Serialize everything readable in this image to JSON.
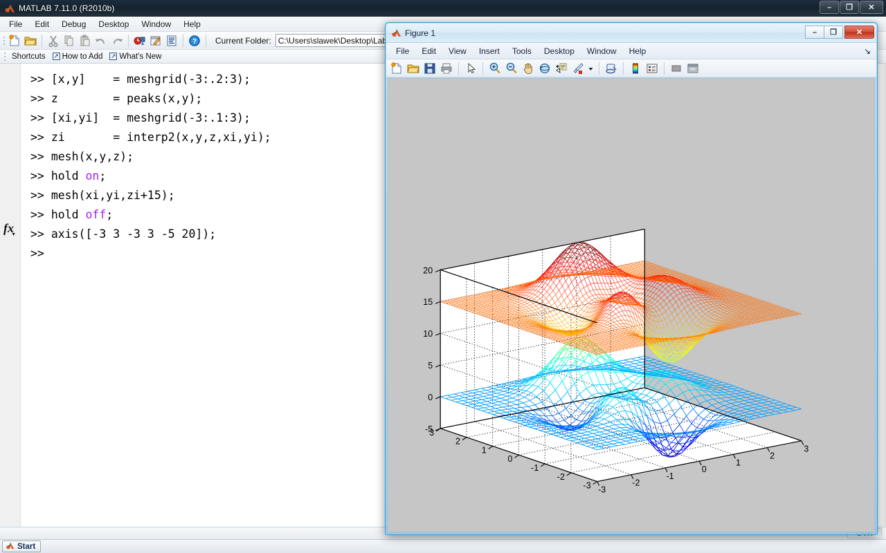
{
  "matlab": {
    "title": "MATLAB  7.11.0 (R2010b)",
    "title_icon": "matlab-logo-icon",
    "window_buttons": [
      {
        "name": "minimize-button",
        "glyph": "–"
      },
      {
        "name": "restore-button",
        "glyph": "❐"
      },
      {
        "name": "close-button",
        "glyph": "✕"
      }
    ],
    "menus": [
      "File",
      "Edit",
      "Debug",
      "Desktop",
      "Window",
      "Help"
    ],
    "toolbar": [
      {
        "name": "new-file-icon",
        "tip": "New"
      },
      {
        "name": "open-file-icon",
        "tip": "Open"
      },
      {
        "name": "separator"
      },
      {
        "name": "cut-icon",
        "tip": "Cut"
      },
      {
        "name": "copy-icon",
        "tip": "Copy"
      },
      {
        "name": "paste-icon",
        "tip": "Paste"
      },
      {
        "name": "undo-icon",
        "tip": "Undo"
      },
      {
        "name": "redo-icon",
        "tip": "Redo"
      },
      {
        "name": "separator"
      },
      {
        "name": "simulink-icon",
        "tip": "Simulink Library"
      },
      {
        "name": "guide-icon",
        "tip": "GUIDE"
      },
      {
        "name": "profiler-icon",
        "tip": "Profiler"
      },
      {
        "name": "separator"
      },
      {
        "name": "help-icon",
        "tip": "Help"
      }
    ],
    "current_folder": {
      "label": "Current Folder:",
      "value": "C:\\Users\\slawek\\Desktop\\Lab",
      "browse_icon": "browse-folder-icon"
    },
    "shortcuts": [
      {
        "name": "shortcuts-label",
        "label": "Shortcuts",
        "arrow": false
      },
      {
        "name": "how-to-add-link",
        "label": "How to Add",
        "arrow": true
      },
      {
        "name": "whats-new-link",
        "label": "What's New",
        "arrow": true
      }
    ],
    "command_window": {
      "prompt": ">>",
      "lines": [
        {
          "prompt": ">> ",
          "parts": [
            {
              "t": "[x,y]    = meshgrid(-3:.2:3);",
              "kw": false
            }
          ]
        },
        {
          "prompt": ">> ",
          "parts": [
            {
              "t": "z        = peaks(x,y);",
              "kw": false
            }
          ]
        },
        {
          "prompt": ">> ",
          "parts": [
            {
              "t": "[xi,yi]  = meshgrid(-3:.1:3);",
              "kw": false
            }
          ]
        },
        {
          "prompt": ">> ",
          "parts": [
            {
              "t": "zi       = interp2(x,y,z,xi,yi);",
              "kw": false
            }
          ]
        },
        {
          "prompt": ">> ",
          "parts": [
            {
              "t": "mesh(x,y,z);",
              "kw": false
            }
          ]
        },
        {
          "prompt": ">> ",
          "parts": [
            {
              "t": "hold ",
              "kw": false
            },
            {
              "t": "on",
              "kw": true
            },
            {
              "t": ";",
              "kw": false
            }
          ]
        },
        {
          "prompt": ">> ",
          "parts": [
            {
              "t": "mesh(xi,yi,zi+15);",
              "kw": false
            }
          ]
        },
        {
          "prompt": ">> ",
          "parts": [
            {
              "t": "hold ",
              "kw": false
            },
            {
              "t": "off",
              "kw": true
            },
            {
              "t": ";",
              "kw": false
            }
          ]
        },
        {
          "prompt": ">> ",
          "parts": [
            {
              "t": "axis([-3 3 -3 3 -5 20]);",
              "kw": false
            }
          ]
        },
        {
          "prompt": ">> ",
          "parts": [
            {
              "t": "",
              "kw": false
            }
          ]
        }
      ]
    },
    "status_bar": {
      "overwrite_indicator": "OVR"
    },
    "start_button": {
      "label": "Start",
      "icon": "matlab-logo-icon"
    }
  },
  "figure": {
    "title": "Figure 1",
    "title_icon": "matlab-logo-icon",
    "window_buttons": [
      {
        "name": "minimize-button",
        "glyph": "–"
      },
      {
        "name": "maximize-button",
        "glyph": "❐"
      },
      {
        "name": "close-button",
        "glyph": "✕"
      }
    ],
    "menus": [
      "File",
      "Edit",
      "View",
      "Insert",
      "Tools",
      "Desktop",
      "Window",
      "Help"
    ],
    "dock_icon": "dock-figure-icon",
    "toolbar": [
      {
        "name": "new-figure-icon",
        "tip": "New Figure"
      },
      {
        "name": "open-file-icon",
        "tip": "Open File"
      },
      {
        "name": "save-figure-icon",
        "tip": "Save Figure"
      },
      {
        "name": "print-figure-icon",
        "tip": "Print Figure"
      },
      {
        "name": "separator"
      },
      {
        "name": "edit-plot-pointer-icon",
        "tip": "Edit Plot"
      },
      {
        "name": "separator"
      },
      {
        "name": "zoom-in-icon",
        "tip": "Zoom In"
      },
      {
        "name": "zoom-out-icon",
        "tip": "Zoom Out"
      },
      {
        "name": "pan-icon",
        "tip": "Pan"
      },
      {
        "name": "rotate-3d-icon",
        "tip": "Rotate 3D"
      },
      {
        "name": "data-cursor-icon",
        "tip": "Data Cursor"
      },
      {
        "name": "brush-icon",
        "tip": "Brush/Select Data"
      },
      {
        "name": "brush-dropdown-icon",
        "tip": "Brush options"
      },
      {
        "name": "separator"
      },
      {
        "name": "link-data-icon",
        "tip": "Link Plot"
      },
      {
        "name": "separator"
      },
      {
        "name": "colorbar-icon",
        "tip": "Insert Colorbar"
      },
      {
        "name": "legend-icon",
        "tip": "Insert Legend"
      },
      {
        "name": "separator"
      },
      {
        "name": "hide-plot-tools-icon",
        "tip": "Hide Plot Tools"
      },
      {
        "name": "show-plot-tools-icon",
        "tip": "Show Plot Tools and Dock Figure"
      }
    ]
  },
  "chart_data": {
    "type": "surface",
    "title": "",
    "xlabel": "",
    "ylabel": "",
    "zlabel": "",
    "grid": true,
    "legend": null,
    "xlim": [
      -3,
      3
    ],
    "ylim": [
      -3,
      3
    ],
    "zlim": [
      -5,
      20
    ],
    "xticks": [
      -3,
      -2,
      -1,
      0,
      1,
      2,
      3
    ],
    "yticks": [
      -3,
      -2,
      -1,
      0,
      1,
      2,
      3
    ],
    "zticks": [
      -5,
      0,
      5,
      10,
      15,
      20
    ],
    "xticklabels": [
      "-3",
      "-2",
      "-1",
      "0",
      "1",
      "2",
      "3"
    ],
    "yticklabels": [
      "3",
      "2",
      "1",
      "0",
      "-1",
      "-2",
      "-3"
    ],
    "zticklabels": [
      "-5",
      "0",
      "5",
      "10",
      "15",
      "20"
    ],
    "view": {
      "azimuth": -37.5,
      "elevation": 30
    },
    "colormap": "jet",
    "series": [
      {
        "name": "mesh(x,y,z)",
        "function": "peaks",
        "grid_step": 0.2,
        "grid_n": 31,
        "z_offset": 0,
        "z_range": [
          -6.5,
          8.1
        ],
        "color_low": "#0000bf",
        "color_high": "#00d4ff",
        "description": "Coarse peaks mesh, cool/blue end of jet colormap"
      },
      {
        "name": "mesh(xi,yi,zi+15)",
        "function": "interp2(peaks)",
        "grid_step": 0.1,
        "grid_n": 61,
        "z_offset": 15,
        "z_range": [
          8.5,
          23.1
        ],
        "color_low": "#ffd800",
        "color_high": "#a00000",
        "description": "Fine interpolated peaks mesh shifted +15, warm/red end of jet colormap"
      }
    ],
    "axes_background": "#ffffff",
    "figure_background": "#c6c6c6"
  }
}
